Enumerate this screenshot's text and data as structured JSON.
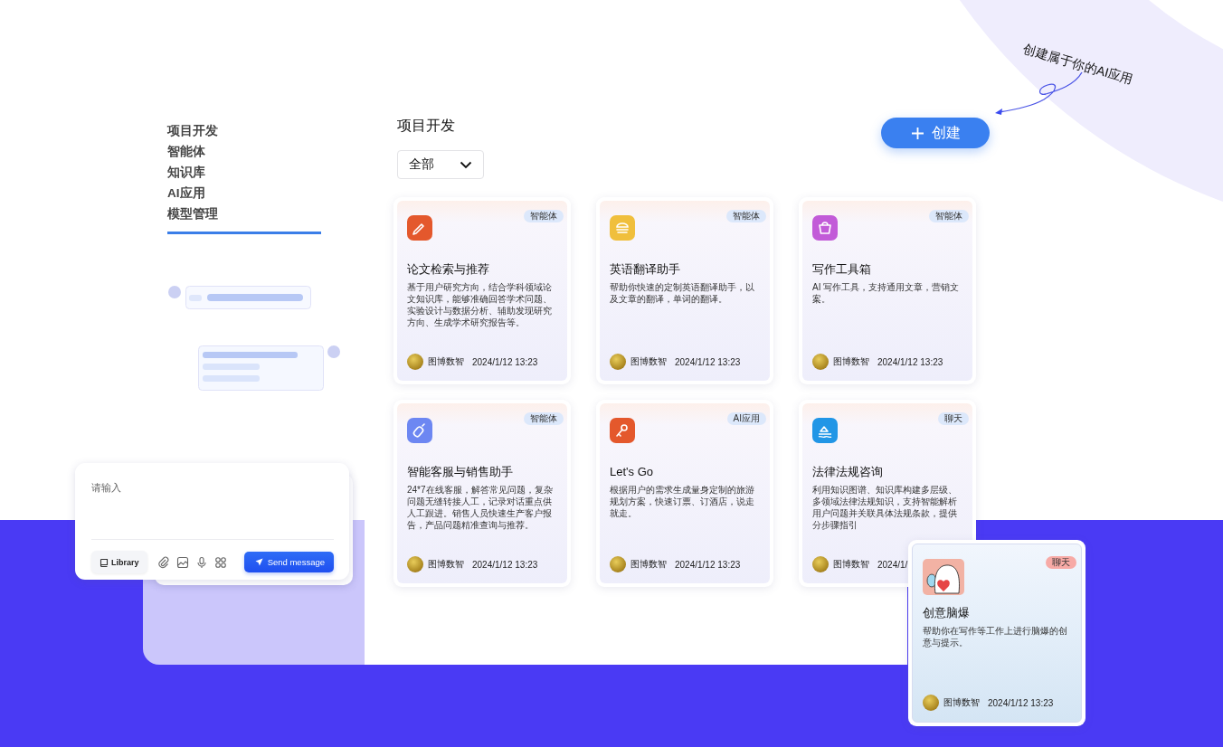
{
  "annotation": {
    "text": "创建属于你的AI应用"
  },
  "create_button": {
    "label": "创建"
  },
  "nav": {
    "items": [
      "项目开发",
      "智能体",
      "知识库",
      "AI应用",
      "模型管理"
    ]
  },
  "section": {
    "title": "项目开发",
    "filter": {
      "value": "全部"
    }
  },
  "cards": [
    {
      "title": "论文检索与推荐",
      "description": "基于用户研究方向，结合学科领域论文知识库，能够准确回答学术问题、实验设计与数据分析、辅助发现研究方向、生成学术研究报告等。",
      "tag": "智能体",
      "author": "图博数智",
      "time": "2024/1/12 13:23",
      "color": "#e4582c"
    },
    {
      "title": "英语翻译助手",
      "description": "帮助你快速的定制英语翻译助手，以及文章的翻译，单词的翻译。",
      "tag": "智能体",
      "author": "图博数智",
      "time": "2024/1/12 13:23",
      "color": "#f0bf3c"
    },
    {
      "title": "写作工具箱",
      "description": "AI 写作工具，支持通用文章，营销文案。",
      "tag": "智能体",
      "author": "图博数智",
      "time": "2024/1/12 13:23",
      "color": "#c25bd8"
    },
    {
      "title": "智能客服与销售助手",
      "description": "24*7在线客服，解答常见问题，复杂问题无缝转接人工，记录对话重点供人工跟进。销售人员快速生产客户报告，产品问题精准查询与推荐。",
      "tag": "智能体",
      "author": "图博数智",
      "time": "2024/1/12 13:23",
      "color": "#6d87f2"
    },
    {
      "title": "Let's Go",
      "description": "根据用户的需求生成量身定制的旅游规划方案，快速订票、订酒店，说走就走。",
      "tag": "AI应用",
      "author": "图博数智",
      "time": "2024/1/12 13:23",
      "color": "#e4582c"
    },
    {
      "title": "法律法规咨询",
      "description": "利用知识图谱、知识库构建多层级、多领域法律法规知识，支持智能解析用户问题并关联具体法规条款，提供分步骤指引",
      "tag": "聊天",
      "author": "图博数智",
      "time": "2024/1/",
      "color": "#2196e6"
    }
  ],
  "featured_card": {
    "title": "创意脑爆",
    "description": "帮助你在写作等工作上进行脑爆的创意与提示。",
    "tag": "聊天",
    "author": "图博数智",
    "time": "2024/1/12 13:23"
  },
  "chat_input": {
    "placeholder": "请输入",
    "library_button": "Library",
    "send_button": "Send message"
  }
}
